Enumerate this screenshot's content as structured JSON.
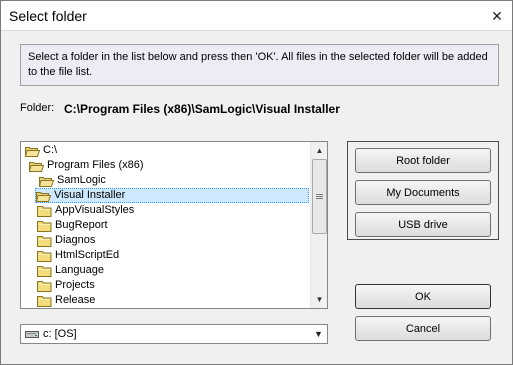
{
  "window": {
    "title": "Select folder",
    "close_glyph": "✕"
  },
  "info_text": "Select a folder in the list below and press then 'OK'. All files in the selected folder will be added to the file list.",
  "folder": {
    "label": "Folder:",
    "path": "C:\\Program Files (x86)\\SamLogic\\Visual Installer"
  },
  "tree": {
    "items": [
      {
        "label": "C:\\",
        "icon": "open-folder-icon"
      },
      {
        "label": "Program Files (x86)",
        "icon": "open-folder-icon"
      },
      {
        "label": "SamLogic",
        "icon": "open-folder-icon"
      },
      {
        "label": "Visual Installer",
        "icon": "open-folder-icon",
        "selected": true
      },
      {
        "label": "AppVisualStyles",
        "icon": "folder-icon"
      },
      {
        "label": "BugReport",
        "icon": "folder-icon"
      },
      {
        "label": "Diagnos",
        "icon": "folder-icon"
      },
      {
        "label": "HtmlScriptEd",
        "icon": "folder-icon"
      },
      {
        "label": "Language",
        "icon": "folder-icon"
      },
      {
        "label": "Projects",
        "icon": "folder-icon"
      },
      {
        "label": "Release",
        "icon": "folder-icon"
      }
    ]
  },
  "drive": {
    "value": "c: [OS]",
    "icon": "drive-icon"
  },
  "buttons": {
    "root_folder": "Root folder",
    "my_documents": "My Documents",
    "usb_drive": "USB drive",
    "ok": "OK",
    "cancel": "Cancel"
  },
  "colors": {
    "selection": "#cde8ff",
    "info_bg": "#ececf5",
    "dialog_bg": "#f0f0f0"
  }
}
